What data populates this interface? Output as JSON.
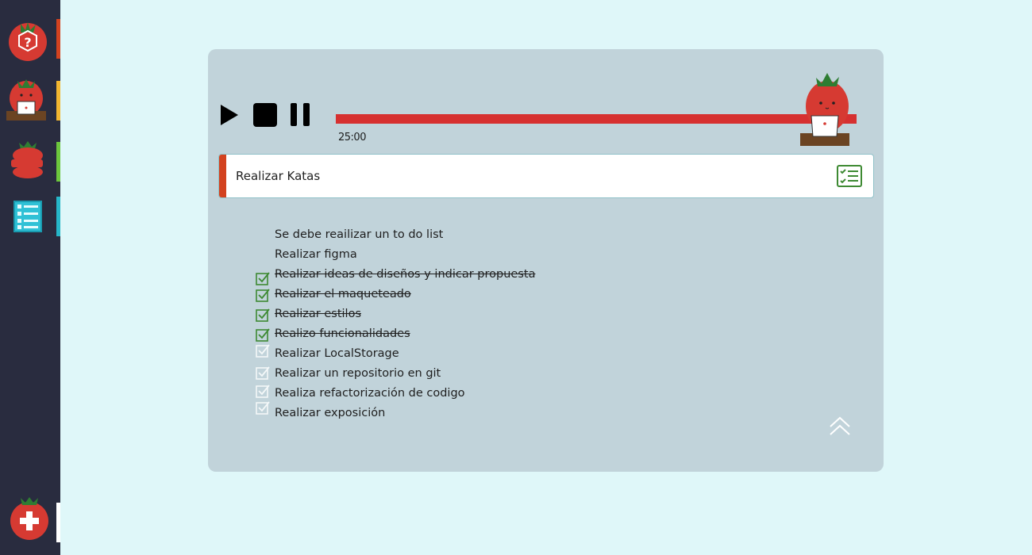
{
  "sidebar": {
    "items": [
      {
        "icon": "help-tomato-icon",
        "accent": "#d3421f"
      },
      {
        "icon": "tomato-laptop-icon",
        "accent": "#f2b630"
      },
      {
        "icon": "tomato-stack-icon",
        "accent": "#6cc63d"
      },
      {
        "icon": "list-icon",
        "accent": "#26b6c8"
      },
      {
        "icon": "add-tomato-icon",
        "accent": "#ffffff"
      }
    ]
  },
  "timer": {
    "time": "25:00",
    "progress": 1.0,
    "bar_color": "#d63030"
  },
  "task": {
    "title": "Realizar Katas",
    "accent": "#d3421f"
  },
  "subtasks": [
    {
      "text": "Se debe reailizar  un to do list",
      "state": "none"
    },
    {
      "text": "Realizar figma",
      "state": "none"
    },
    {
      "text": "Realizar ideas de diseños y indicar propuesta",
      "state": "done"
    },
    {
      "text": "Realizar el maqueteado",
      "state": "done"
    },
    {
      "text": "Realizar estilos",
      "state": "done"
    },
    {
      "text": "Realizo funcionalidades",
      "state": "done"
    },
    {
      "text": "Realizar LocalStorage",
      "state": "pending"
    },
    {
      "text": "Realizar un repositorio en git",
      "state": "pending"
    },
    {
      "text": "Realiza refactorización de codigo",
      "state": "pending"
    },
    {
      "text": "Realizar exposición",
      "state": "pending"
    }
  ]
}
